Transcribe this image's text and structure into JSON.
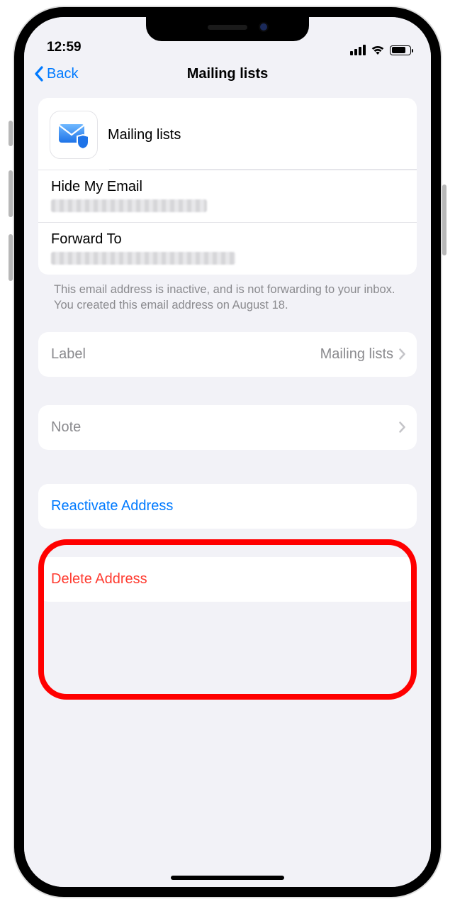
{
  "status": {
    "time": "12:59"
  },
  "nav": {
    "back": "Back",
    "title": "Mailing lists"
  },
  "header": {
    "title": "Mailing lists"
  },
  "info": {
    "hide_label": "Hide My Email",
    "forward_label": "Forward To",
    "footnote": "This email address is inactive, and is not forwarding to your inbox. You created this email address on August 18."
  },
  "label_row": {
    "label": "Label",
    "value": "Mailing lists"
  },
  "note_row": {
    "label": "Note"
  },
  "actions": {
    "reactivate": "Reactivate Address",
    "delete": "Delete Address"
  }
}
